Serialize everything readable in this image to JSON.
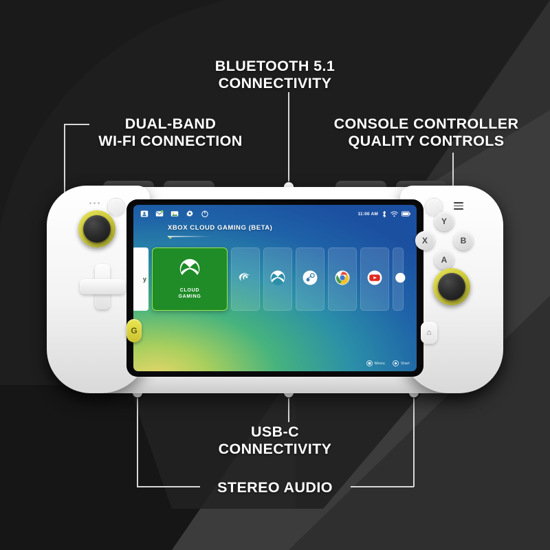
{
  "callouts": [
    {
      "id": "bluetooth",
      "text": "BLUETOOTH 5.1\nCONNECTIVITY"
    },
    {
      "id": "wifi",
      "text": "DUAL-BAND\nWI-FI CONNECTION"
    },
    {
      "id": "controls",
      "text": "CONSOLE CONTROLLER\nQUALITY CONTROLS"
    },
    {
      "id": "usbc",
      "text": "USB-C\nCONNECTIVITY"
    },
    {
      "id": "stereo",
      "text": "STEREO AUDIO"
    }
  ],
  "device": {
    "screen": {
      "status_bar": {
        "left_icons": [
          "contacts-icon",
          "mail-icon",
          "gallery-icon",
          "settings-icon",
          "power-icon"
        ],
        "time": "11:00 AM",
        "right_icons": [
          "bluetooth-icon",
          "wifi-icon",
          "battery-icon"
        ]
      },
      "section_title": "XBOX CLOUD GAMING (BETA)",
      "partial_tile_text": "y",
      "featured_tile": {
        "icon": "xbox-icon",
        "label": "CLOUD\nGAMING",
        "color": "#1f8c28",
        "border_color": "#9ee84f"
      },
      "app_tiles": [
        {
          "name": "nvidia-icon"
        },
        {
          "name": "xbox-icon"
        },
        {
          "name": "steam-icon"
        },
        {
          "name": "chrome-icon"
        },
        {
          "name": "youtube-icon"
        },
        {
          "name": "app-icon-partial"
        }
      ],
      "footer_buttons": [
        {
          "glyph": "square",
          "label": "Menu"
        },
        {
          "glyph": "circle",
          "label": "Start"
        }
      ]
    },
    "face_buttons": [
      {
        "id": "y",
        "label": "Y"
      },
      {
        "id": "x",
        "label": "X"
      },
      {
        "id": "b",
        "label": "B"
      },
      {
        "id": "a",
        "label": "A"
      }
    ],
    "logitech_button_label": "G",
    "home_button_label": "⌂"
  },
  "colors": {
    "background_dark": "#161616",
    "background_mid": "#3a3a3a",
    "accent_yellow": "#e9e55a",
    "xbox_green": "#1f8c28",
    "text_white": "#ffffff",
    "lead_line": "#d8d8d8"
  }
}
